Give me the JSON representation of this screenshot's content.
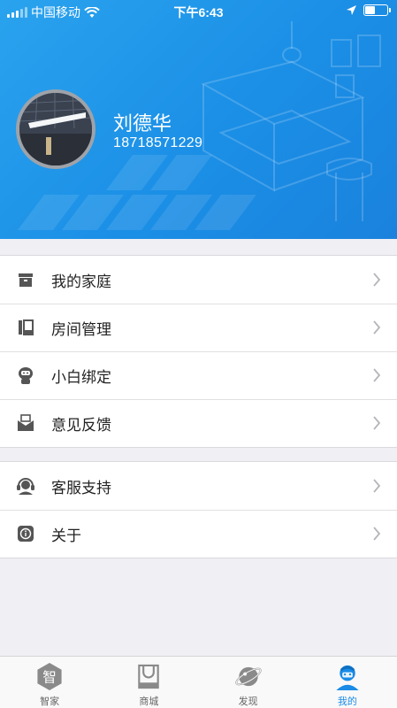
{
  "status_bar": {
    "carrier": "中国移动",
    "time": "下午6:43"
  },
  "profile": {
    "name": "刘德华",
    "phone": "18718571229"
  },
  "menu_group_1": [
    {
      "label": "我的家庭",
      "icon": "home-box-icon"
    },
    {
      "label": "房间管理",
      "icon": "room-door-icon"
    },
    {
      "label": "小白绑定",
      "icon": "robot-icon"
    },
    {
      "label": "意见反馈",
      "icon": "feedback-mail-icon"
    }
  ],
  "menu_group_2": [
    {
      "label": "客服支持",
      "icon": "headset-icon"
    },
    {
      "label": "关于",
      "icon": "info-icon"
    }
  ],
  "tabs": [
    {
      "label": "智家",
      "icon": "smart-home-icon",
      "glyph": "智"
    },
    {
      "label": "商城",
      "icon": "shopping-bag-icon"
    },
    {
      "label": "发现",
      "icon": "planet-icon"
    },
    {
      "label": "我的",
      "icon": "user-icon",
      "active": true
    }
  ],
  "colors": {
    "accent": "#1a8be6",
    "header": "#1b8fe6",
    "icon": "#555555"
  }
}
